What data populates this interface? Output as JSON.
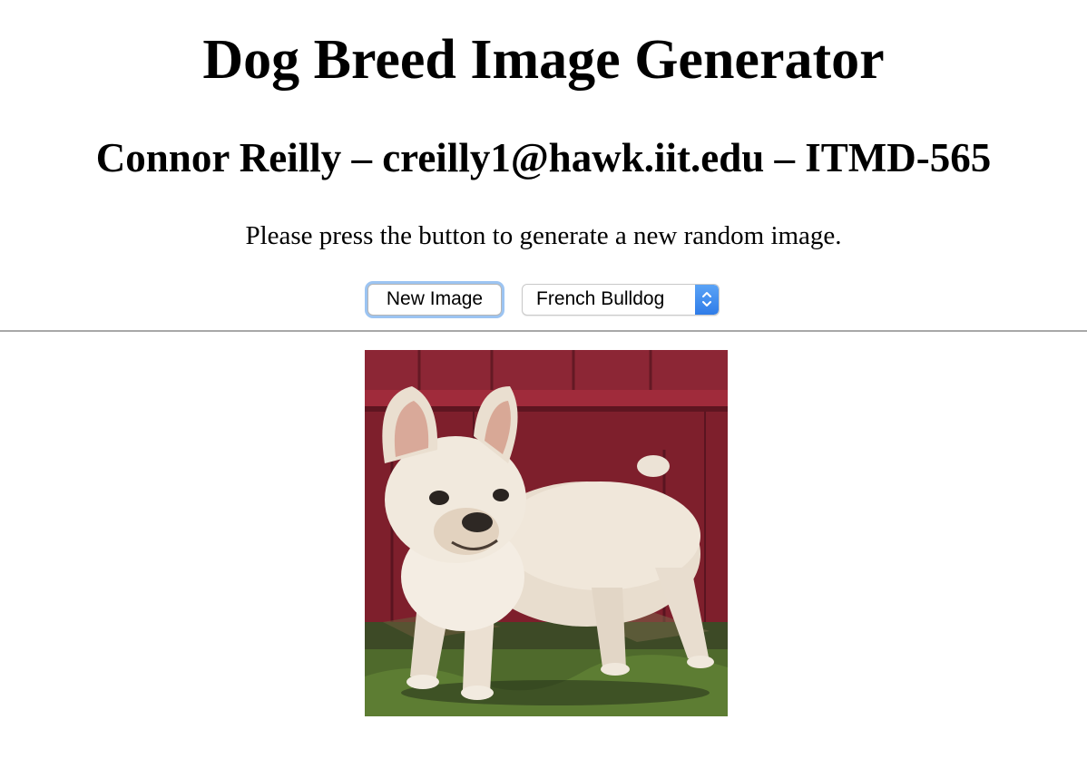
{
  "header": {
    "title": "Dog Breed Image Generator",
    "subtitle": "Connor Reilly – creilly1@hawk.iit.edu – ITMD-565"
  },
  "main": {
    "instructions": "Please press the button to generate a new random image.",
    "new_image_label": "New Image",
    "breed_select": {
      "selected": "French Bulldog"
    },
    "image": {
      "subject": "french-bulldog-photo"
    }
  },
  "colors": {
    "button_focus_ring": "#9cc4f2",
    "select_arrow_bg": "#3a86ec",
    "divider": "#a8a8a8"
  }
}
